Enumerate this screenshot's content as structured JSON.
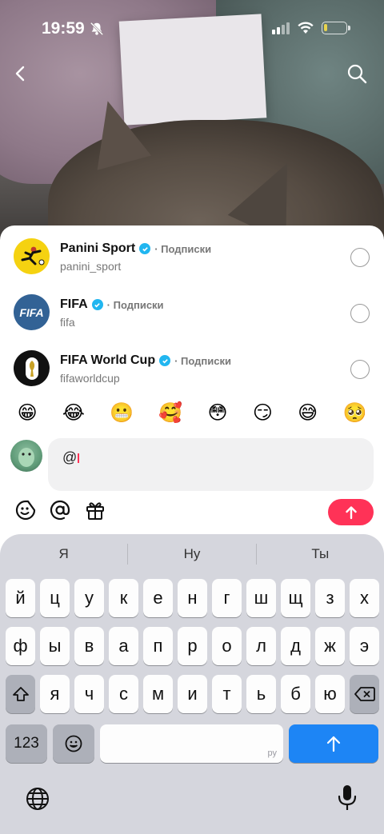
{
  "status_bar": {
    "time": "19:59",
    "icons": [
      "bell-slash-icon",
      "cellular-signal-icon",
      "wifi-icon",
      "battery-icon"
    ]
  },
  "nav": {
    "back_icon": "chevron-left-icon",
    "search_icon": "search-icon"
  },
  "mentions": [
    {
      "name": "Panini Sport",
      "follow_label": "· Подписки",
      "handle": "panini_sport",
      "verified": true
    },
    {
      "name": "FIFA",
      "follow_label": "· Подписки",
      "handle": "fifa",
      "verified": true,
      "avatar_text": "FIFA"
    },
    {
      "name": "FIFA World Cup",
      "follow_label": "· Подписки",
      "handle": "fifaworldcup",
      "verified": true
    }
  ],
  "emoji_bar": [
    "😁",
    "😂",
    "😬",
    "🥰",
    "😳",
    "😏",
    "😅",
    "🥺"
  ],
  "composer": {
    "value": "@"
  },
  "toolbar": {
    "icons": [
      "emoji-icon",
      "at-icon",
      "gift-icon",
      "send-arrow-icon"
    ]
  },
  "keyboard": {
    "suggestions": [
      "Я",
      "Ну",
      "Ты"
    ],
    "row1": [
      "й",
      "ц",
      "у",
      "к",
      "е",
      "н",
      "г",
      "ш",
      "щ",
      "з",
      "х"
    ],
    "row2": [
      "ф",
      "ы",
      "в",
      "а",
      "п",
      "р",
      "о",
      "л",
      "д",
      "ж",
      "э"
    ],
    "row3": [
      "я",
      "ч",
      "с",
      "м",
      "и",
      "т",
      "ь",
      "б",
      "ю"
    ],
    "numbers_key": "123",
    "space_lang": "ру",
    "accent_color": "#ff3257",
    "return_color": "#1d85f5"
  }
}
